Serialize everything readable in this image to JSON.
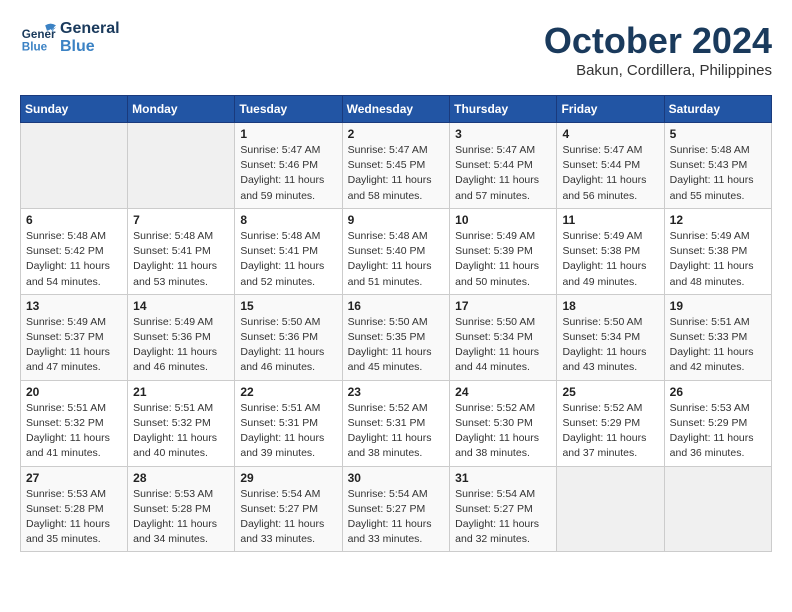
{
  "header": {
    "logo": {
      "general": "General",
      "blue": "Blue"
    },
    "title": "October 2024",
    "subtitle": "Bakun, Cordillera, Philippines"
  },
  "calendar": {
    "days": [
      "Sunday",
      "Monday",
      "Tuesday",
      "Wednesday",
      "Thursday",
      "Friday",
      "Saturday"
    ],
    "weeks": [
      [
        {
          "day": "",
          "sunrise": "",
          "sunset": "",
          "daylight": ""
        },
        {
          "day": "",
          "sunrise": "",
          "sunset": "",
          "daylight": ""
        },
        {
          "day": "1",
          "sunrise": "Sunrise: 5:47 AM",
          "sunset": "Sunset: 5:46 PM",
          "daylight": "Daylight: 11 hours and 59 minutes."
        },
        {
          "day": "2",
          "sunrise": "Sunrise: 5:47 AM",
          "sunset": "Sunset: 5:45 PM",
          "daylight": "Daylight: 11 hours and 58 minutes."
        },
        {
          "day": "3",
          "sunrise": "Sunrise: 5:47 AM",
          "sunset": "Sunset: 5:44 PM",
          "daylight": "Daylight: 11 hours and 57 minutes."
        },
        {
          "day": "4",
          "sunrise": "Sunrise: 5:47 AM",
          "sunset": "Sunset: 5:44 PM",
          "daylight": "Daylight: 11 hours and 56 minutes."
        },
        {
          "day": "5",
          "sunrise": "Sunrise: 5:48 AM",
          "sunset": "Sunset: 5:43 PM",
          "daylight": "Daylight: 11 hours and 55 minutes."
        }
      ],
      [
        {
          "day": "6",
          "sunrise": "Sunrise: 5:48 AM",
          "sunset": "Sunset: 5:42 PM",
          "daylight": "Daylight: 11 hours and 54 minutes."
        },
        {
          "day": "7",
          "sunrise": "Sunrise: 5:48 AM",
          "sunset": "Sunset: 5:41 PM",
          "daylight": "Daylight: 11 hours and 53 minutes."
        },
        {
          "day": "8",
          "sunrise": "Sunrise: 5:48 AM",
          "sunset": "Sunset: 5:41 PM",
          "daylight": "Daylight: 11 hours and 52 minutes."
        },
        {
          "day": "9",
          "sunrise": "Sunrise: 5:48 AM",
          "sunset": "Sunset: 5:40 PM",
          "daylight": "Daylight: 11 hours and 51 minutes."
        },
        {
          "day": "10",
          "sunrise": "Sunrise: 5:49 AM",
          "sunset": "Sunset: 5:39 PM",
          "daylight": "Daylight: 11 hours and 50 minutes."
        },
        {
          "day": "11",
          "sunrise": "Sunrise: 5:49 AM",
          "sunset": "Sunset: 5:38 PM",
          "daylight": "Daylight: 11 hours and 49 minutes."
        },
        {
          "day": "12",
          "sunrise": "Sunrise: 5:49 AM",
          "sunset": "Sunset: 5:38 PM",
          "daylight": "Daylight: 11 hours and 48 minutes."
        }
      ],
      [
        {
          "day": "13",
          "sunrise": "Sunrise: 5:49 AM",
          "sunset": "Sunset: 5:37 PM",
          "daylight": "Daylight: 11 hours and 47 minutes."
        },
        {
          "day": "14",
          "sunrise": "Sunrise: 5:49 AM",
          "sunset": "Sunset: 5:36 PM",
          "daylight": "Daylight: 11 hours and 46 minutes."
        },
        {
          "day": "15",
          "sunrise": "Sunrise: 5:50 AM",
          "sunset": "Sunset: 5:36 PM",
          "daylight": "Daylight: 11 hours and 46 minutes."
        },
        {
          "day": "16",
          "sunrise": "Sunrise: 5:50 AM",
          "sunset": "Sunset: 5:35 PM",
          "daylight": "Daylight: 11 hours and 45 minutes."
        },
        {
          "day": "17",
          "sunrise": "Sunrise: 5:50 AM",
          "sunset": "Sunset: 5:34 PM",
          "daylight": "Daylight: 11 hours and 44 minutes."
        },
        {
          "day": "18",
          "sunrise": "Sunrise: 5:50 AM",
          "sunset": "Sunset: 5:34 PM",
          "daylight": "Daylight: 11 hours and 43 minutes."
        },
        {
          "day": "19",
          "sunrise": "Sunrise: 5:51 AM",
          "sunset": "Sunset: 5:33 PM",
          "daylight": "Daylight: 11 hours and 42 minutes."
        }
      ],
      [
        {
          "day": "20",
          "sunrise": "Sunrise: 5:51 AM",
          "sunset": "Sunset: 5:32 PM",
          "daylight": "Daylight: 11 hours and 41 minutes."
        },
        {
          "day": "21",
          "sunrise": "Sunrise: 5:51 AM",
          "sunset": "Sunset: 5:32 PM",
          "daylight": "Daylight: 11 hours and 40 minutes."
        },
        {
          "day": "22",
          "sunrise": "Sunrise: 5:51 AM",
          "sunset": "Sunset: 5:31 PM",
          "daylight": "Daylight: 11 hours and 39 minutes."
        },
        {
          "day": "23",
          "sunrise": "Sunrise: 5:52 AM",
          "sunset": "Sunset: 5:31 PM",
          "daylight": "Daylight: 11 hours and 38 minutes."
        },
        {
          "day": "24",
          "sunrise": "Sunrise: 5:52 AM",
          "sunset": "Sunset: 5:30 PM",
          "daylight": "Daylight: 11 hours and 38 minutes."
        },
        {
          "day": "25",
          "sunrise": "Sunrise: 5:52 AM",
          "sunset": "Sunset: 5:29 PM",
          "daylight": "Daylight: 11 hours and 37 minutes."
        },
        {
          "day": "26",
          "sunrise": "Sunrise: 5:53 AM",
          "sunset": "Sunset: 5:29 PM",
          "daylight": "Daylight: 11 hours and 36 minutes."
        }
      ],
      [
        {
          "day": "27",
          "sunrise": "Sunrise: 5:53 AM",
          "sunset": "Sunset: 5:28 PM",
          "daylight": "Daylight: 11 hours and 35 minutes."
        },
        {
          "day": "28",
          "sunrise": "Sunrise: 5:53 AM",
          "sunset": "Sunset: 5:28 PM",
          "daylight": "Daylight: 11 hours and 34 minutes."
        },
        {
          "day": "29",
          "sunrise": "Sunrise: 5:54 AM",
          "sunset": "Sunset: 5:27 PM",
          "daylight": "Daylight: 11 hours and 33 minutes."
        },
        {
          "day": "30",
          "sunrise": "Sunrise: 5:54 AM",
          "sunset": "Sunset: 5:27 PM",
          "daylight": "Daylight: 11 hours and 33 minutes."
        },
        {
          "day": "31",
          "sunrise": "Sunrise: 5:54 AM",
          "sunset": "Sunset: 5:27 PM",
          "daylight": "Daylight: 11 hours and 32 minutes."
        },
        {
          "day": "",
          "sunrise": "",
          "sunset": "",
          "daylight": ""
        },
        {
          "day": "",
          "sunrise": "",
          "sunset": "",
          "daylight": ""
        }
      ]
    ]
  }
}
